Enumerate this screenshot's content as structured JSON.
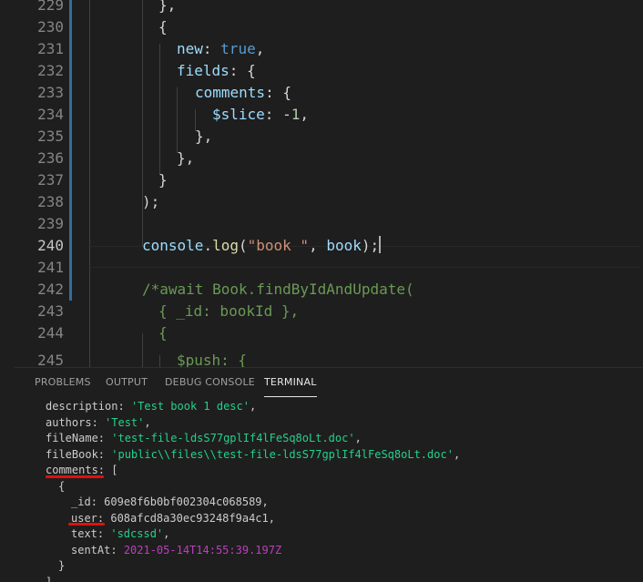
{
  "editor": {
    "lines": [
      {
        "num": "229",
        "text": "},",
        "indent": 2,
        "modified": true
      },
      {
        "num": "230",
        "text": "{",
        "indent": 2,
        "modified": true
      },
      {
        "num": "231",
        "k": "new",
        "p": ": ",
        "v": "true",
        "t": ",",
        "indent": 3,
        "modified": true
      },
      {
        "num": "232",
        "k": "fields",
        "p": ": {",
        "indent": 3,
        "modified": true
      },
      {
        "num": "233",
        "k": "comments",
        "p": ": {",
        "indent": 4,
        "modified": true
      },
      {
        "num": "234",
        "k": "$slice",
        "p": ": ",
        "minus": "-",
        "v": "1",
        "t": ",",
        "indent": 5,
        "modified": true
      },
      {
        "num": "235",
        "text": "},",
        "indent": 4,
        "modified": true
      },
      {
        "num": "236",
        "text": "},",
        "indent": 3,
        "modified": true
      },
      {
        "num": "237",
        "text": "}",
        "indent": 2,
        "modified": true
      },
      {
        "num": "238",
        "text": ");",
        "indent": 1,
        "modified": true
      },
      {
        "num": "239",
        "text": "",
        "indent": 0,
        "modified": true
      },
      {
        "num": "240",
        "obj": "console",
        "dot": ".",
        "fn": "log",
        "open": "(",
        "str": "\"book \"",
        "comma": ", ",
        "var": "book",
        "close": ");",
        "indent": 1,
        "modified": true,
        "active": true
      },
      {
        "num": "241",
        "text": "",
        "indent": 0,
        "modified": true
      },
      {
        "num": "242",
        "comment": "/*await Book.findByIdAndUpdate(",
        "indent": 1,
        "modified": true
      },
      {
        "num": "243",
        "comment": "{ _id: bookId },",
        "indent": 2,
        "modified": false
      },
      {
        "num": "244",
        "comment": "{",
        "indent": 2,
        "modified": false
      },
      {
        "num": "245",
        "comment": "$push: {",
        "indent": 3,
        "modified": false
      }
    ]
  },
  "panel": {
    "tabs": [
      "PROBLEMS",
      "OUTPUT",
      "DEBUG CONSOLE",
      "TERMINAL"
    ],
    "active_tab": "TERMINAL"
  },
  "terminal": {
    "description_key": "description",
    "description_val": "'Test book 1 desc'",
    "authors_key": "authors",
    "authors_val": "'Test'",
    "filename_key": "fileName",
    "filename_val": "'test-file-ldsS77gplIf4lFeSq8oLt.doc'",
    "filebook_key": "fileBook",
    "filebook_val": "'public\\\\files\\\\test-file-ldsS77gplIf4lFeSq8oLt.doc'",
    "comments_key": "comments",
    "comments_open": "[",
    "obj_open": "{",
    "id_key": "_id",
    "id_val": "609e8f6b0bf002304c068589",
    "user_key": "user",
    "user_val": "608afcd8a30ec93248f9a4c1",
    "text_key": "text",
    "text_val": "'sdcssd'",
    "sentat_key": "sentAt",
    "sentat_val": "2021-05-14T14:55:39.197Z",
    "obj_close": "}",
    "comments_close": "],"
  },
  "colors": {
    "background": "#1e1e1e",
    "keyword": "#569cd6",
    "property": "#9cdcfe",
    "number": "#b5cea8",
    "string": "#ce9178",
    "comment": "#6a9955",
    "term_string": "#23d18b",
    "term_date": "#bc3fbc",
    "annotation": "#e01010"
  }
}
